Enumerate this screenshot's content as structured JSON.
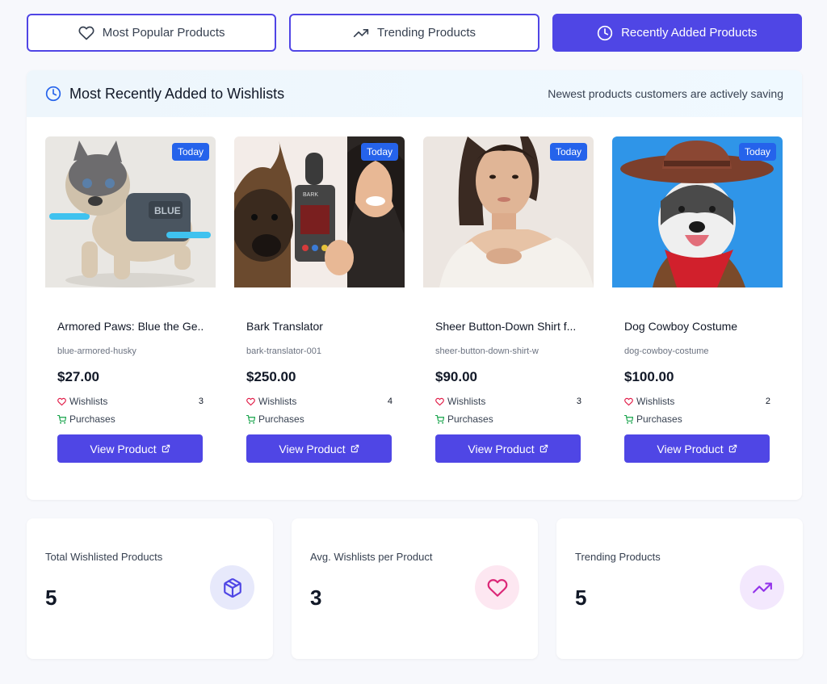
{
  "tabs": [
    {
      "label": "Most Popular Products",
      "icon": "heart-icon"
    },
    {
      "label": "Trending Products",
      "icon": "trending-up-icon"
    },
    {
      "label": "Recently Added Products",
      "icon": "clock-icon",
      "active": true
    }
  ],
  "panel": {
    "title": "Most Recently Added to Wishlists",
    "subtitle": "Newest products customers are actively saving"
  },
  "labels": {
    "wishlists": "Wishlists",
    "purchases": "Purchases",
    "view_product": "View Product"
  },
  "products": [
    {
      "name": "Armored Paws: Blue the Ge...",
      "slug": "blue-armored-husky",
      "price": "$27.00",
      "badge": "Today",
      "wishlists": "3",
      "image": "toy husky figurine with armor"
    },
    {
      "name": "Bark Translator",
      "slug": "bark-translator-001",
      "price": "$250.00",
      "badge": "Today",
      "wishlists": "4",
      "image": "dog and woman with bark translator device"
    },
    {
      "name": "Sheer Button-Down Shirt f...",
      "slug": "sheer-button-down-shirt-w",
      "price": "$90.00",
      "badge": "Today",
      "wishlists": "3",
      "image": "woman in white off-shoulder shirt"
    },
    {
      "name": "Dog Cowboy Costume",
      "slug": "dog-cowboy-costume",
      "price": "$100.00",
      "badge": "Today",
      "wishlists": "2",
      "image": "husky wearing cowboy hat and red bandana"
    }
  ],
  "stats": [
    {
      "label": "Total Wishlisted Products",
      "value": "5",
      "icon": "package-icon",
      "color": "#4f46e5",
      "bg": "#e7e9fb"
    },
    {
      "label": "Avg. Wishlists per Product",
      "value": "3",
      "icon": "heart-icon",
      "color": "#db2777",
      "bg": "#fde7f1"
    },
    {
      "label": "Trending Products",
      "value": "5",
      "icon": "trending-up-icon",
      "color": "#9333ea",
      "bg": "#f3e8fd"
    }
  ],
  "colors": {
    "accent": "#4f46e5",
    "badge": "#2563eb",
    "wishlist_icon": "#e11d48",
    "purchase_icon": "#16a34a"
  }
}
